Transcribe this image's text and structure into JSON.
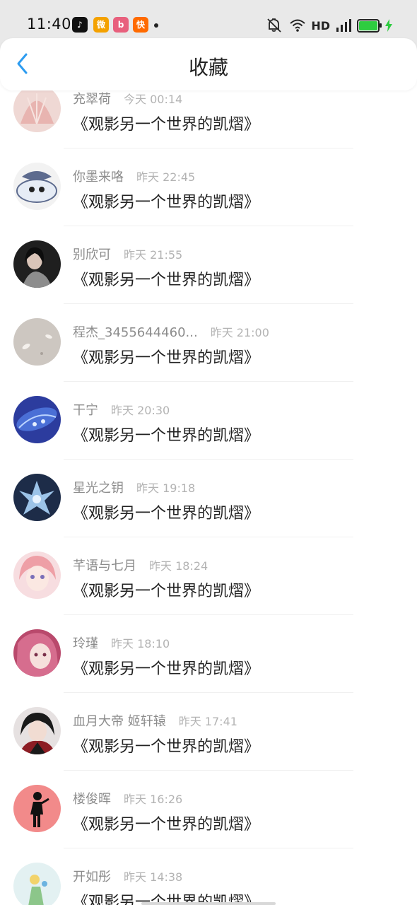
{
  "status_bar": {
    "time": "11:40",
    "network": "HD",
    "apps": [
      {
        "name": "douyin-icon",
        "glyph": "♪",
        "color": "#111111"
      },
      {
        "name": "weibo-icon",
        "glyph": "微",
        "color": "#f4a100"
      },
      {
        "name": "bilibili-icon",
        "glyph": "b",
        "color": "#e8607d"
      },
      {
        "name": "kuaishou-icon",
        "glyph": "快",
        "color": "#ff6a00"
      }
    ]
  },
  "header": {
    "title": "收藏"
  },
  "favorites": [
    {
      "user": "充翠荷",
      "time": "今天 00:14",
      "book": "《观影另一个世界的凯熠》",
      "avatar_color": "#e8b4b0"
    },
    {
      "user": "你墨来咯",
      "time": "昨天 22:45",
      "book": "《观影另一个世界的凯熠》",
      "avatar_color": "#5d6b8e"
    },
    {
      "user": "别欣可",
      "time": "昨天 21:55",
      "book": "《观影另一个世界的凯熠》",
      "avatar_color": "#2a2a2a"
    },
    {
      "user": "程杰_3455644460...",
      "time": "昨天 21:00",
      "book": "《观影另一个世界的凯熠》",
      "avatar_color": "#c8c2bc"
    },
    {
      "user": "干宁",
      "time": "昨天 20:30",
      "book": "《观影另一个世界的凯熠》",
      "avatar_color": "#3346a8"
    },
    {
      "user": "星光之钥",
      "time": "昨天 19:18",
      "book": "《观影另一个世界的凯熠》",
      "avatar_color": "#2e4870"
    },
    {
      "user": "芊语与七月",
      "time": "昨天 18:24",
      "book": "《观影另一个世界的凯熠》",
      "avatar_color": "#ee9fa6"
    },
    {
      "user": "玲瑾",
      "time": "昨天 18:10",
      "book": "《观影另一个世界的凯熠》",
      "avatar_color": "#c8577a"
    },
    {
      "user": "血月大帝 姬轩辕",
      "time": "昨天 17:41",
      "book": "《观影另一个世界的凯熠》",
      "avatar_color": "#3b1f22"
    },
    {
      "user": "楼俊晖",
      "time": "昨天 16:26",
      "book": "《观影另一个世界的凯熠》",
      "avatar_color": "#f28a8a"
    },
    {
      "user": "开如彤",
      "time": "昨天 14:38",
      "book": "《观影另一个世界的凯熠》",
      "avatar_color": "#cfe6e8"
    }
  ],
  "colors": {
    "accent": "#2d9cf0",
    "status_bg": "#e9e9e9",
    "battery": "#2ecc40"
  }
}
